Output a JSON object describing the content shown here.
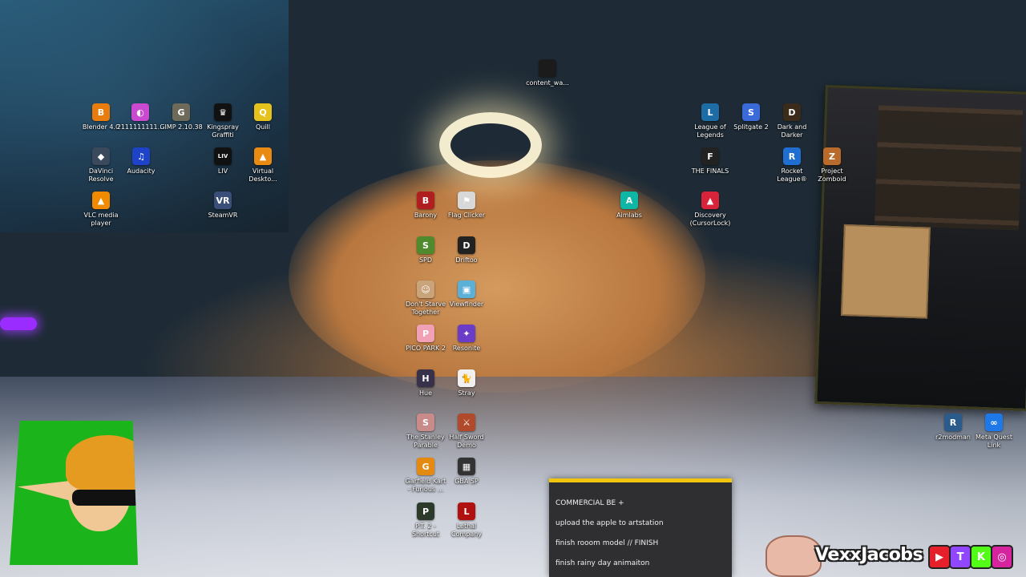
{
  "desktop_icons": [
    {
      "label": "content_wa...",
      "icon": "content-file-icon",
      "color": "#1b1b1b",
      "glyph": ""
    },
    {
      "label": "Blender 4.0",
      "icon": "blender-icon",
      "color": "#e87d0d",
      "glyph": "B"
    },
    {
      "label": "2111111111...",
      "icon": "color-swirl-icon",
      "color": "#c94ad1",
      "glyph": "◐"
    },
    {
      "label": "GIMP 2.10.38",
      "icon": "gimp-icon",
      "color": "#6e6a5a",
      "glyph": "G"
    },
    {
      "label": "Kingspray\nGraffiti",
      "icon": "crown-icon",
      "color": "#111111",
      "glyph": "♛"
    },
    {
      "label": "Quill",
      "icon": "quill-icon",
      "color": "#e5c21c",
      "glyph": "Q"
    },
    {
      "label": "DaVinci\nResolve",
      "icon": "davinci-icon",
      "color": "#3a4a5c",
      "glyph": "◆"
    },
    {
      "label": "Audacity",
      "icon": "headphones-icon",
      "color": "#1f43c8",
      "glyph": "♫"
    },
    {
      "label": "LIV",
      "icon": "liv-icon",
      "color": "#111111",
      "glyph": "LIV"
    },
    {
      "label": "Virtual\nDeskto...",
      "icon": "virtual-desktop-icon",
      "color": "#e98a12",
      "glyph": "▲"
    },
    {
      "label": "VLC media\nplayer",
      "icon": "vlc-cone-icon",
      "color": "#f08a00",
      "glyph": "▲"
    },
    {
      "label": "SteamVR",
      "icon": "steamvr-icon",
      "color": "#3a4e7a",
      "glyph": "VR"
    },
    {
      "label": "Barony",
      "icon": "barony-shield-icon",
      "color": "#b01f1f",
      "glyph": "B"
    },
    {
      "label": "Flag Clicker",
      "icon": "flag-icon",
      "color": "#d8d8d8",
      "glyph": "⚑"
    },
    {
      "label": "SPD",
      "icon": "spd-icon",
      "color": "#4f8a2f",
      "glyph": "S"
    },
    {
      "label": "Driftoo",
      "icon": "driftoo-icon",
      "color": "#222222",
      "glyph": "D"
    },
    {
      "label": "Don't Starve\nTogether",
      "icon": "dont-starve-icon",
      "color": "#c9a37a",
      "glyph": "☺"
    },
    {
      "label": "Viewfinder",
      "icon": "viewfinder-icon",
      "color": "#5bb0d8",
      "glyph": "▣"
    },
    {
      "label": "PICO PARK 2",
      "icon": "pico-park-icon",
      "color": "#f2a0b6",
      "glyph": "P"
    },
    {
      "label": "Resonite",
      "icon": "resonite-icon",
      "color": "#6a3cc8",
      "glyph": "✦"
    },
    {
      "label": "Hue",
      "icon": "hue-icon",
      "color": "#37324a",
      "glyph": "H"
    },
    {
      "label": "Stray",
      "icon": "stray-cat-icon",
      "color": "#f0f0f0",
      "glyph": "🐈"
    },
    {
      "label": "The Stanley\nParable",
      "icon": "stanley-parable-icon",
      "color": "#c98a8a",
      "glyph": "S"
    },
    {
      "label": "Half Sword\nDemo",
      "icon": "half-sword-icon",
      "color": "#b04a2a",
      "glyph": "⚔"
    },
    {
      "label": "Garfield Kart\n- Furious ...",
      "icon": "garfield-kart-icon",
      "color": "#e58a10",
      "glyph": "G"
    },
    {
      "label": "GBA SP",
      "icon": "gba-sp-icon",
      "color": "#333333",
      "glyph": "▦"
    },
    {
      "label": "P.T. 2 -\nShortcut",
      "icon": "pt2-icon",
      "color": "#2b3a2b",
      "glyph": "P"
    },
    {
      "label": "Lethal\nCompany",
      "icon": "lethal-company-icon",
      "color": "#b01010",
      "glyph": "L"
    },
    {
      "label": "Aimlabs",
      "icon": "aimlabs-icon",
      "color": "#0fb5a5",
      "glyph": "A"
    },
    {
      "label": "League of\nLegends",
      "icon": "league-of-legends-icon",
      "color": "#1d6ca6",
      "glyph": "L"
    },
    {
      "label": "Splitgate 2",
      "icon": "splitgate-icon",
      "color": "#3a6ad8",
      "glyph": "S"
    },
    {
      "label": "Dark and\nDarker",
      "icon": "dark-and-darker-icon",
      "color": "#3b2b1b",
      "glyph": "D"
    },
    {
      "label": "THE FINALS",
      "icon": "the-finals-icon",
      "color": "#222222",
      "glyph": "F"
    },
    {
      "label": "Rocket\nLeague®",
      "icon": "rocket-league-icon",
      "color": "#1f6fd1",
      "glyph": "R"
    },
    {
      "label": "Project\nZomboid",
      "icon": "project-zomboid-icon",
      "color": "#b86b2a",
      "glyph": "Z"
    },
    {
      "label": "Discovery\n(CursorLock)",
      "icon": "cursorlock-icon",
      "color": "#d8233a",
      "glyph": "▲"
    },
    {
      "label": "r2modman",
      "icon": "r2modman-icon",
      "color": "#2a5b8a",
      "glyph": "R"
    },
    {
      "label": "Meta Quest\nLink",
      "icon": "meta-quest-icon",
      "color": "#1f78e8",
      "glyph": "∞"
    }
  ],
  "todo": {
    "accent": "#f1c40f",
    "items": [
      "COMMERCIAL BE +",
      "upload the apple to artstation",
      " finish rooom model // FINISH",
      "finish rainy day animaiton"
    ]
  },
  "brand": {
    "name": "VexxJacobs",
    "socials": [
      {
        "icon": "youtube-icon",
        "color": "#e5202a",
        "glyph": "▶"
      },
      {
        "icon": "twitch-icon",
        "color": "#9146ff",
        "glyph": "T"
      },
      {
        "icon": "kick-icon",
        "color": "#53fc18",
        "glyph": "K"
      },
      {
        "icon": "instagram-icon",
        "color": "#d6249f",
        "glyph": "◎"
      }
    ]
  }
}
